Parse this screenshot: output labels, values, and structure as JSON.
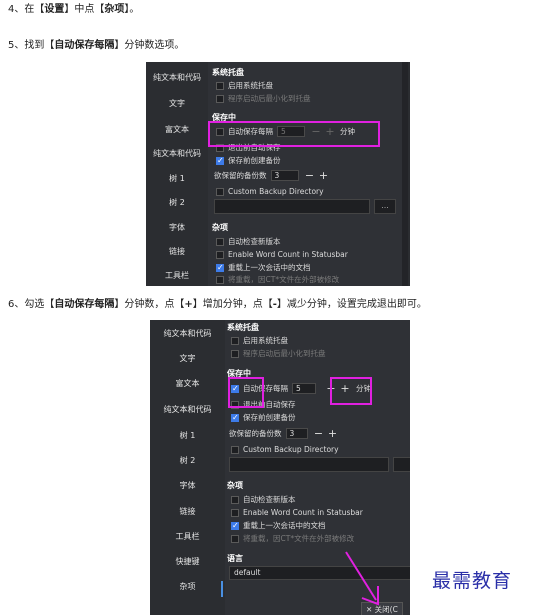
{
  "steps": {
    "step4": {
      "prefix": "4、在【",
      "k1": "设置",
      "mid": "】中点【",
      "k2": "杂项",
      "suffix": "】。"
    },
    "step5": {
      "prefix": "5、找到【",
      "k1": "自动保存每隔",
      "suffix": "】分钟数选项。"
    },
    "step6": {
      "prefix": "6、勾选【",
      "k1": "自动保存每隔",
      "mid1": "】分钟数，点【",
      "k2": "+",
      "mid2": "】增加分钟，点【",
      "k3": "-",
      "suffix": "】减少分钟，设置完成退出即可。"
    }
  },
  "screenshot1": {
    "sidebar": [
      "纯文本和代码",
      "文字",
      "富文本",
      "纯文本和代码",
      "树 1",
      "树 2",
      "字体",
      "链接",
      "工具栏"
    ],
    "sections": {
      "system": "系统托盘",
      "save": "保存中",
      "misc": "杂项"
    },
    "rows": {
      "tray": "启用系统托盘",
      "minimize": "程序启动后最小化到托盘",
      "autosave": "自动保存每隔",
      "autosave_value": "5",
      "autosave_unit": "分钟",
      "exit_save": "退出前自动保存",
      "backup": "保存前创建备份",
      "backup_count": "欲保留的备份数",
      "backup_count_value": "3",
      "custom_backup": "Custom Backup Directory",
      "browse": "...",
      "check_update": "自动检查新版本",
      "word_count": "Enable Word Count in Statusbar",
      "reload": "重载上一次会话中的文档",
      "reload_note": "将重载，因CT*文件在外部被修改"
    },
    "plus": "+",
    "minus": "−"
  },
  "screenshot2": {
    "sidebar": [
      "纯文本和代码",
      "文字",
      "富文本",
      "纯文本和代码",
      "树 1",
      "树 2",
      "字体",
      "链接",
      "工具栏",
      "快捷键",
      "杂项"
    ],
    "sections": {
      "system": "系统托盘",
      "save": "保存中",
      "misc": "杂项",
      "lang": "语言"
    },
    "rows": {
      "tray": "启用系统托盘",
      "minimize": "程序启动后最小化到托盘",
      "autosave": "自动保存每隔",
      "autosave_value": "5",
      "autosave_unit": "分钟",
      "exit_save": "退出前自动保存",
      "backup": "保存前创建备份",
      "backup_count": "欲保留的备份数",
      "backup_count_value": "3",
      "custom_backup": "Custom Backup Directory",
      "check_update": "自动检查新版本",
      "word_count": "Enable Word Count in Statusbar",
      "reload": "重载上一次会话中的文档",
      "reload_note": "将重载，因CT*文件在外部被修改",
      "language_value": "default"
    },
    "close_button": "✕ 关闭(C",
    "plus": "+",
    "minus": "−"
  },
  "watermark": "最需教育",
  "colors": {
    "highlight": "#e020e0",
    "watermark": "#2a2fa8",
    "checkbox_on": "#3d7be8"
  }
}
